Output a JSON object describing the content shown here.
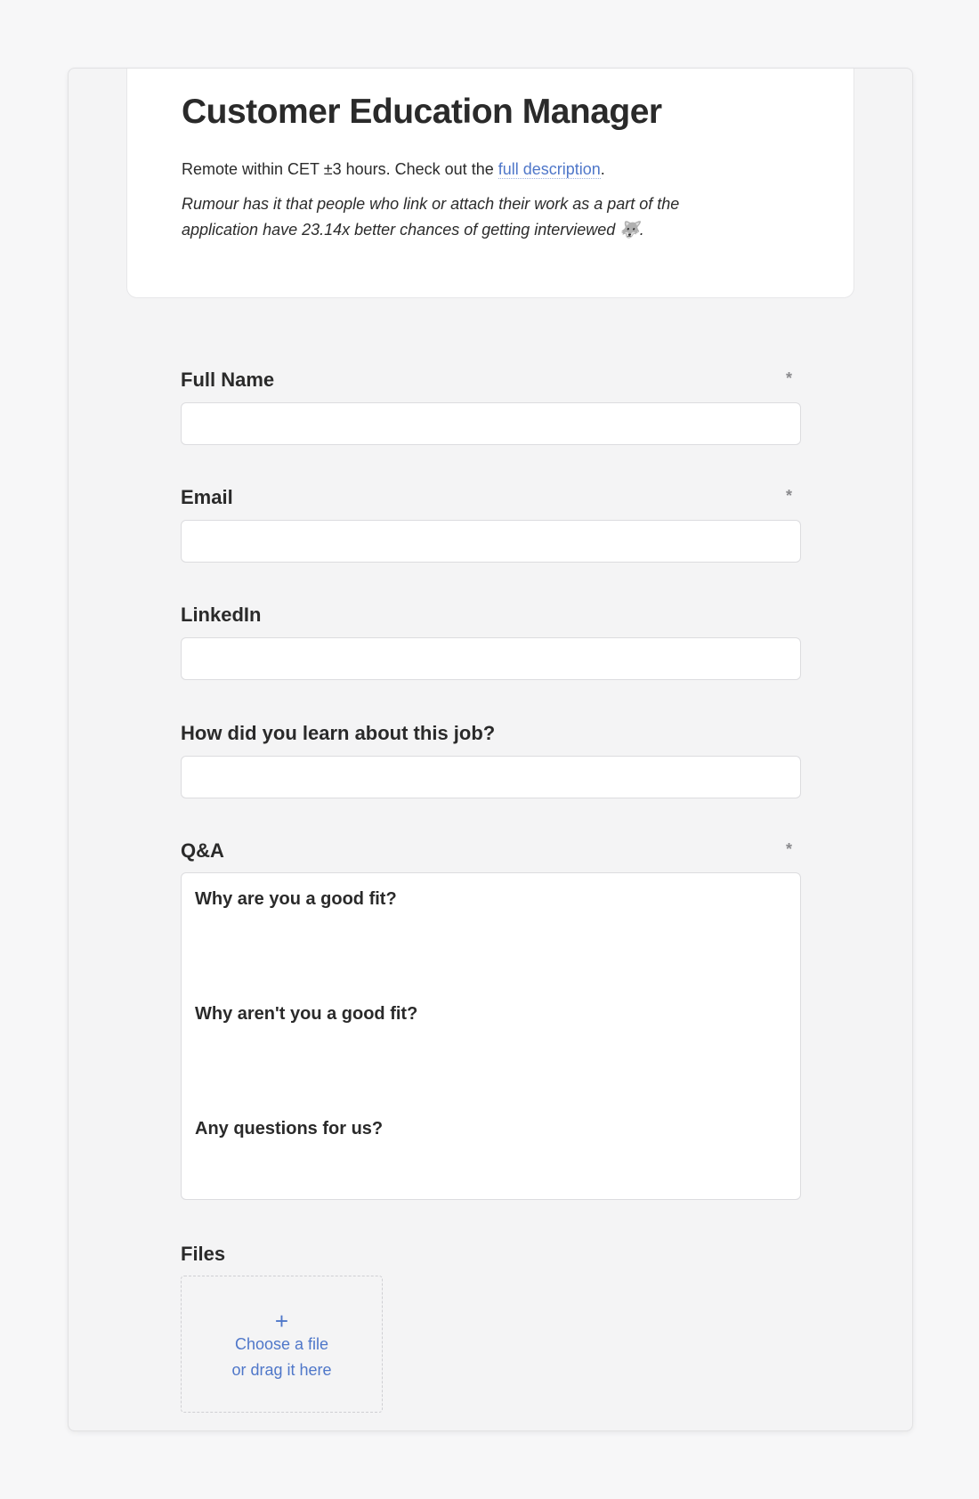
{
  "job": {
    "title": "Customer Education Manager",
    "intro_prefix": "Remote within CET ±3 hours. Check out the ",
    "intro_link": "full description",
    "intro_suffix": ".",
    "note": "Rumour has it that people who link or attach their work as a part of the application have 23.14x better chances of getting interviewed 🐺."
  },
  "form": {
    "required_marker": "*",
    "full_name": {
      "label": "Full Name",
      "value": ""
    },
    "email": {
      "label": "Email",
      "value": ""
    },
    "linkedin": {
      "label": "LinkedIn",
      "value": ""
    },
    "source": {
      "label": "How did you learn about this job?",
      "value": ""
    },
    "qa": {
      "label": "Q&A",
      "questions": [
        "Why are you a good fit?",
        "Why aren't you a good fit?",
        "Any questions for us?"
      ]
    },
    "files": {
      "label": "Files",
      "plus": "+",
      "line1": "Choose a file",
      "line2": "or drag it here"
    }
  },
  "colors": {
    "accent": "#4f77c9",
    "background": "#f7f7f8",
    "card": "#ffffff"
  }
}
